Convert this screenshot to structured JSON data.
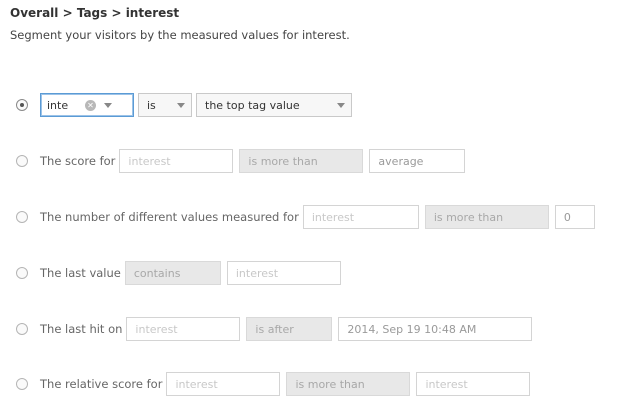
{
  "header": {
    "breadcrumb": "Overall > Tags > interest",
    "subtitle": "Segment your visitors by the measured values for interest."
  },
  "rows": [
    {
      "tag_value": "inte",
      "operator": "is",
      "value": "the top tag value",
      "checked": true
    },
    {
      "label": "The score for",
      "tag_placeholder": "interest",
      "operator": "is more than",
      "value": "average"
    },
    {
      "label": "The number of different values measured for",
      "tag_placeholder": "interest",
      "operator": "is more than",
      "value": "0"
    },
    {
      "label": "The last value",
      "operator": "contains",
      "value_placeholder": "interest"
    },
    {
      "label": "The last hit on",
      "tag_placeholder": "interest",
      "operator": "is after",
      "value": "2014, Sep 19 10:48 AM"
    },
    {
      "label": "The relative score for",
      "tag_placeholder": "interest",
      "operator": "is more than",
      "value_placeholder": "interest"
    }
  ]
}
